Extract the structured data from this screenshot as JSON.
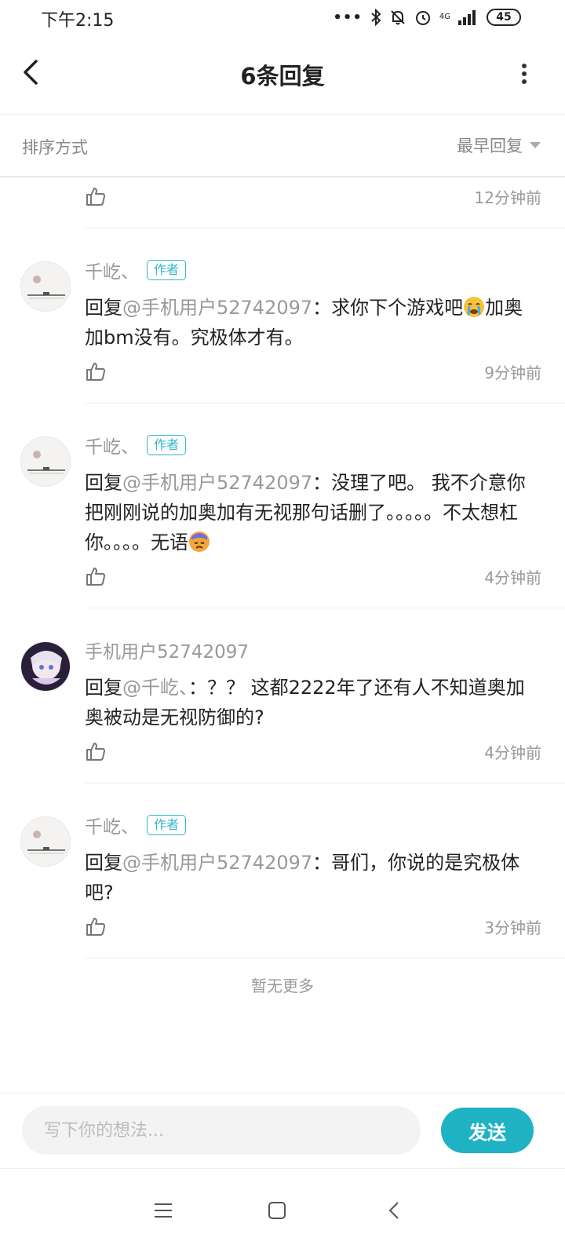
{
  "status_bar": {
    "time": "下午2:15",
    "network": "4G",
    "battery": "45"
  },
  "header": {
    "title": "6条回复"
  },
  "sort": {
    "label": "排序方式",
    "selected": "最早回复"
  },
  "partial_item": {
    "time": "12分钟前"
  },
  "comments": [
    {
      "name": "千屹、",
      "badge": "作者",
      "reply_prefix": "回复",
      "mention": "@手机用户52742097",
      "text": "：求你下个游戏吧",
      "emoji": "crying-face",
      "text_after": "加奥加bm没有。究极体才有。",
      "time": "9分钟前"
    },
    {
      "name": "千屹、",
      "badge": "作者",
      "reply_prefix": "回复",
      "mention": "@手机用户52742097",
      "text": "：没理了吧。 我不介意你把刚刚说的加奥加有无视那句话删了。。。。。不太想杠你。。。。无语",
      "emoji": "sweat-face",
      "text_after": "",
      "time": "4分钟前"
    },
    {
      "name": "手机用户52742097",
      "badge": "",
      "reply_prefix": "回复",
      "mention": "@千屹、",
      "text": "：？？ 这都2222年了还有人不知道奥加奥被动是无视防御的?",
      "emoji": "",
      "text_after": "",
      "time": "4分钟前"
    },
    {
      "name": "千屹、",
      "badge": "作者",
      "reply_prefix": "回复",
      "mention": "@手机用户52742097",
      "text": "：哥们，你说的是究极体吧?",
      "emoji": "",
      "text_after": "",
      "time": "3分钟前"
    }
  ],
  "footer_note": "暂无更多",
  "composer": {
    "placeholder": "写下你的想法...",
    "send_label": "发送"
  },
  "colors": {
    "accent": "#1fb2c3",
    "muted": "#999999"
  }
}
